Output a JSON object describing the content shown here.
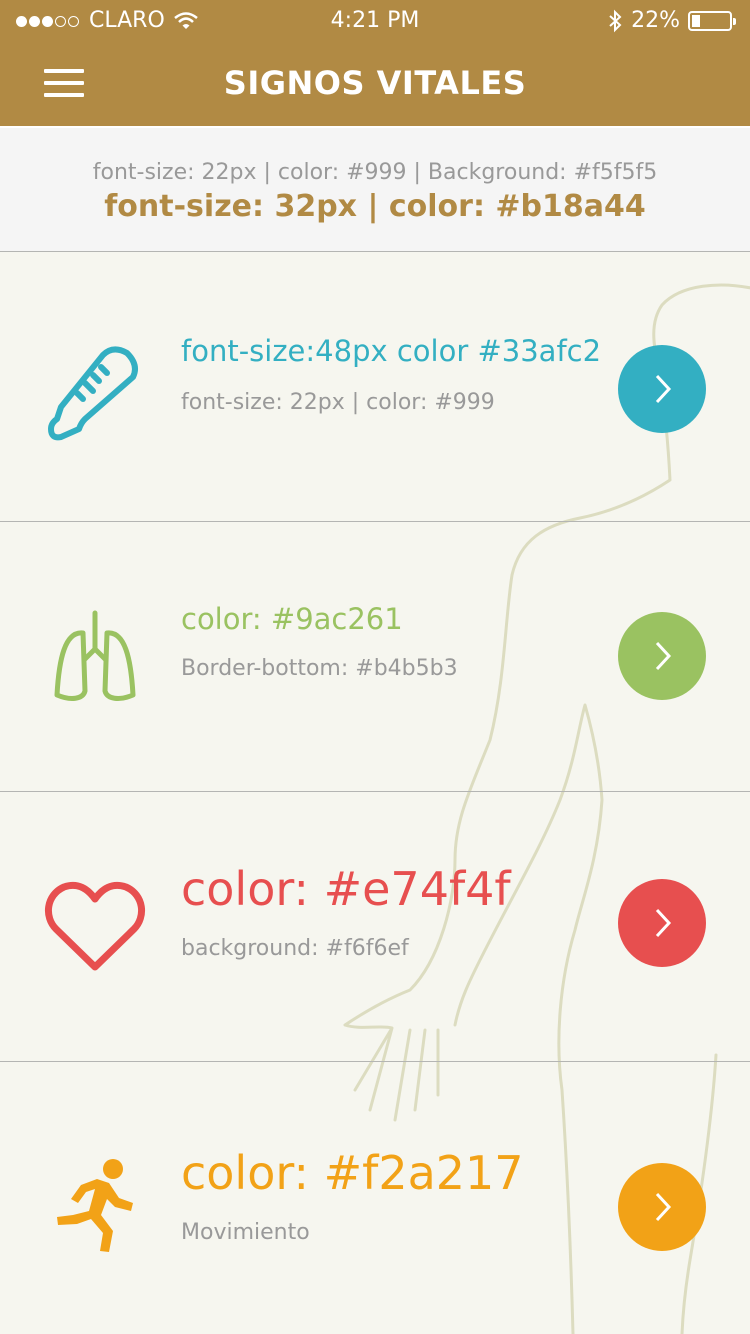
{
  "status_bar": {
    "signal_filled": 3,
    "signal_total": 5,
    "carrier": "CLARO",
    "time": "4:21 PM",
    "battery_text": "22%",
    "battery_level": 0.22
  },
  "header": {
    "title": "SIGNOS VITALES",
    "menu_icon": "hamburger-menu-icon",
    "background": "#b18a44"
  },
  "subheader": {
    "line1": "font-size: 22px | color: #999 | Background:  #f5f5f5",
    "line2": "font-size: 32px | color: #b18a44",
    "background": "#f5f5f5"
  },
  "items": [
    {
      "icon": "thermometer-icon",
      "title": "font-size:48px color #33afc2",
      "subtitle": "font-size: 22px | color: #999",
      "color": "#33afc2"
    },
    {
      "icon": "lungs-icon",
      "title": "color: #9ac261",
      "subtitle": "Border-bottom: #b4b5b3",
      "color": "#9ac261"
    },
    {
      "icon": "heart-icon",
      "title": "color: #e74f4f",
      "subtitle": "background: #f6f6ef",
      "color": "#e74f4f"
    },
    {
      "icon": "running-person-icon",
      "title": "color: #f2a217",
      "subtitle": "Movimiento",
      "color": "#f2a217"
    }
  ]
}
